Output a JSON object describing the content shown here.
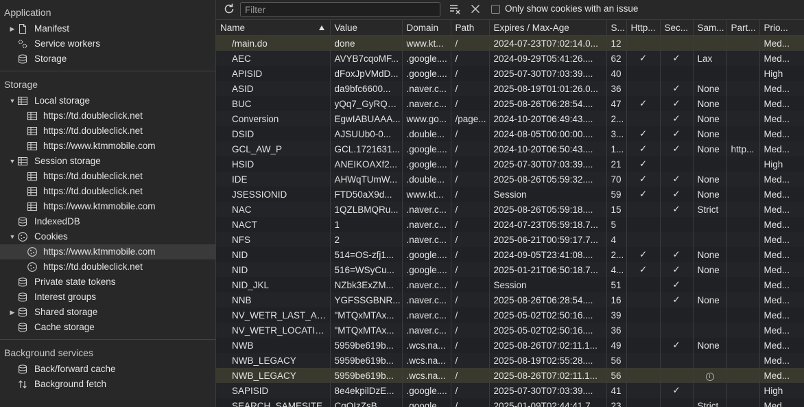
{
  "sidebar": {
    "application": {
      "header": "Application",
      "items": [
        "Manifest",
        "Service workers",
        "Storage"
      ]
    },
    "storage": {
      "header": "Storage",
      "local_storage": "Local storage",
      "local_origins": [
        "https://td.doubleclick.net",
        "https://td.doubleclick.net",
        "https://www.ktmmobile.com"
      ],
      "session_storage": "Session storage",
      "session_origins": [
        "https://td.doubleclick.net",
        "https://td.doubleclick.net",
        "https://www.ktmmobile.com"
      ],
      "indexeddb": "IndexedDB",
      "cookies": "Cookies",
      "cookie_origins": [
        "https://www.ktmmobile.com",
        "https://td.doubleclick.net"
      ],
      "private_state_tokens": "Private state tokens",
      "interest_groups": "Interest groups",
      "shared_storage": "Shared storage",
      "cache_storage": "Cache storage"
    },
    "background": {
      "header": "Background services",
      "items": [
        "Back/forward cache",
        "Background fetch"
      ]
    }
  },
  "toolbar": {
    "filter_placeholder": "Filter",
    "filter_value": "",
    "only_issue_label": "Only show cookies with an issue",
    "only_issue_checked": false
  },
  "table": {
    "columns": [
      "Name",
      "Value",
      "Domain",
      "Path",
      "Expires / Max-Age",
      "S...",
      "Http...",
      "Sec...",
      "Sam...",
      "Part...",
      "Prio..."
    ],
    "sorted_by": "Name",
    "sort_dir": "ascending",
    "rows": [
      {
        "name": "/main.do",
        "value": "done",
        "domain": "www.kt...",
        "path": "/",
        "expires": "2024-07-23T07:02:14.0...",
        "size": "12",
        "http": "",
        "secure": "",
        "samesite": "",
        "partition": "",
        "priority": "Med...",
        "highlight": true
      },
      {
        "name": "AEC",
        "value": "AVYB7cqoMF...",
        "domain": ".google....",
        "path": "/",
        "expires": "2024-09-29T05:41:26....",
        "size": "62",
        "http": "✓",
        "secure": "✓",
        "samesite": "Lax",
        "partition": "",
        "priority": "Med..."
      },
      {
        "name": "APISID",
        "value": "dFoxJpVMdD...",
        "domain": ".google....",
        "path": "/",
        "expires": "2025-07-30T07:03:39....",
        "size": "40",
        "http": "",
        "secure": "",
        "samesite": "",
        "partition": "",
        "priority": "High"
      },
      {
        "name": "ASID",
        "value": "da9bfc6600...",
        "domain": ".naver.c...",
        "path": "/",
        "expires": "2025-08-19T01:01:26.0...",
        "size": "36",
        "http": "",
        "secure": "✓",
        "samesite": "None",
        "partition": "",
        "priority": "Med..."
      },
      {
        "name": "BUC",
        "value": "yQq7_GyRQC...",
        "domain": ".naver.c...",
        "path": "/",
        "expires": "2025-08-26T06:28:54....",
        "size": "47",
        "http": "✓",
        "secure": "✓",
        "samesite": "None",
        "partition": "",
        "priority": "Med..."
      },
      {
        "name": "Conversion",
        "value": "EgwIABUAAA...",
        "domain": "www.go...",
        "path": "/page...",
        "expires": "2024-10-20T06:49:43....",
        "size": "2...",
        "http": "",
        "secure": "✓",
        "samesite": "None",
        "partition": "",
        "priority": "Med..."
      },
      {
        "name": "DSID",
        "value": "AJSUUb0-0...",
        "domain": ".double...",
        "path": "/",
        "expires": "2024-08-05T00:00:00....",
        "size": "3...",
        "http": "✓",
        "secure": "✓",
        "samesite": "None",
        "partition": "",
        "priority": "Med..."
      },
      {
        "name": "GCL_AW_P",
        "value": "GCL.1721631...",
        "domain": ".google....",
        "path": "/",
        "expires": "2024-10-20T06:50:43....",
        "size": "1...",
        "http": "✓",
        "secure": "✓",
        "samesite": "None",
        "partition": "http...",
        "priority": "Med..."
      },
      {
        "name": "HSID",
        "value": "ANEIKOAXf2...",
        "domain": ".google....",
        "path": "/",
        "expires": "2025-07-30T07:03:39....",
        "size": "21",
        "http": "✓",
        "secure": "",
        "samesite": "",
        "partition": "",
        "priority": "High"
      },
      {
        "name": "IDE",
        "value": "AHWqTUmW...",
        "domain": ".double...",
        "path": "/",
        "expires": "2025-08-26T05:59:32....",
        "size": "70",
        "http": "✓",
        "secure": "✓",
        "samesite": "None",
        "partition": "",
        "priority": "Med..."
      },
      {
        "name": "JSESSIONID",
        "value": "FTD50aX9d...",
        "domain": "www.kt...",
        "path": "/",
        "expires": "Session",
        "size": "59",
        "http": "✓",
        "secure": "✓",
        "samesite": "None",
        "partition": "",
        "priority": "Med..."
      },
      {
        "name": "NAC",
        "value": "1QZLBMQRu...",
        "domain": ".naver.c...",
        "path": "/",
        "expires": "2025-08-26T05:59:18....",
        "size": "15",
        "http": "",
        "secure": "✓",
        "samesite": "Strict",
        "partition": "",
        "priority": "Med..."
      },
      {
        "name": "NACT",
        "value": "1",
        "domain": ".naver.c...",
        "path": "/",
        "expires": "2024-07-23T05:59:18.7...",
        "size": "5",
        "http": "",
        "secure": "",
        "samesite": "",
        "partition": "",
        "priority": "Med..."
      },
      {
        "name": "NFS",
        "value": "2",
        "domain": ".naver.c...",
        "path": "/",
        "expires": "2025-06-21T00:59:17.7...",
        "size": "4",
        "http": "",
        "secure": "",
        "samesite": "",
        "partition": "",
        "priority": "Med..."
      },
      {
        "name": "NID",
        "value": "514=OS-zfj1...",
        "domain": ".google....",
        "path": "/",
        "expires": "2024-09-05T23:41:08....",
        "size": "2...",
        "http": "✓",
        "secure": "✓",
        "samesite": "None",
        "partition": "",
        "priority": "Med..."
      },
      {
        "name": "NID",
        "value": "516=WSyCu...",
        "domain": ".google....",
        "path": "/",
        "expires": "2025-01-21T06:50:18.7...",
        "size": "4...",
        "http": "✓",
        "secure": "✓",
        "samesite": "None",
        "partition": "",
        "priority": "Med..."
      },
      {
        "name": "NID_JKL",
        "value": "NZbk3ExZM...",
        "domain": ".naver.c...",
        "path": "/",
        "expires": "Session",
        "size": "51",
        "http": "",
        "secure": "✓",
        "samesite": "",
        "partition": "",
        "priority": "Med..."
      },
      {
        "name": "NNB",
        "value": "YGFSSGBNR...",
        "domain": ".naver.c...",
        "path": "/",
        "expires": "2025-08-26T06:28:54....",
        "size": "16",
        "http": "",
        "secure": "✓",
        "samesite": "None",
        "partition": "",
        "priority": "Med..."
      },
      {
        "name": "NV_WETR_LAST_AC...",
        "value": "\"MTQxMTAx...",
        "domain": ".naver.c...",
        "path": "/",
        "expires": "2025-05-02T02:50:16....",
        "size": "39",
        "http": "",
        "secure": "",
        "samesite": "",
        "partition": "",
        "priority": "Med..."
      },
      {
        "name": "NV_WETR_LOCATIO...",
        "value": "\"MTQxMTAx...",
        "domain": ".naver.c...",
        "path": "/",
        "expires": "2025-05-02T02:50:16....",
        "size": "36",
        "http": "",
        "secure": "",
        "samesite": "",
        "partition": "",
        "priority": "Med..."
      },
      {
        "name": "NWB",
        "value": "5959be619b...",
        "domain": ".wcs.na...",
        "path": "/",
        "expires": "2025-08-26T07:02:11.1...",
        "size": "49",
        "http": "",
        "secure": "✓",
        "samesite": "None",
        "partition": "",
        "priority": "Med..."
      },
      {
        "name": "NWB_LEGACY",
        "value": "5959be619b...",
        "domain": ".wcs.na...",
        "path": "/",
        "expires": "2025-08-19T02:55:28....",
        "size": "56",
        "http": "",
        "secure": "",
        "samesite": "",
        "partition": "",
        "priority": "Med..."
      },
      {
        "name": "NWB_LEGACY",
        "value": "5959be619b...",
        "domain": ".wcs.na...",
        "path": "/",
        "expires": "2025-08-26T07:02:11.1...",
        "size": "56",
        "http": "",
        "secure": "",
        "samesite": "ⓘ",
        "partition": "",
        "priority": "Med...",
        "highlight": true
      },
      {
        "name": "SAPISID",
        "value": "8e4ekpilDzE...",
        "domain": ".google....",
        "path": "/",
        "expires": "2025-07-30T07:03:39....",
        "size": "41",
        "http": "",
        "secure": "✓",
        "samesite": "",
        "partition": "",
        "priority": "High"
      },
      {
        "name": "SEARCH_SAMESITE",
        "value": "CgQIzZsB...",
        "domain": ".google....",
        "path": "/",
        "expires": "2025-01-09T02:44:41.7...",
        "size": "23",
        "http": "",
        "secure": "",
        "samesite": "Strict",
        "partition": "",
        "priority": "Med..."
      }
    ]
  },
  "colors": {
    "background": "#202124",
    "sidebar": "#282828",
    "selected_row": "#39392e",
    "text": "#e3e3e3"
  }
}
